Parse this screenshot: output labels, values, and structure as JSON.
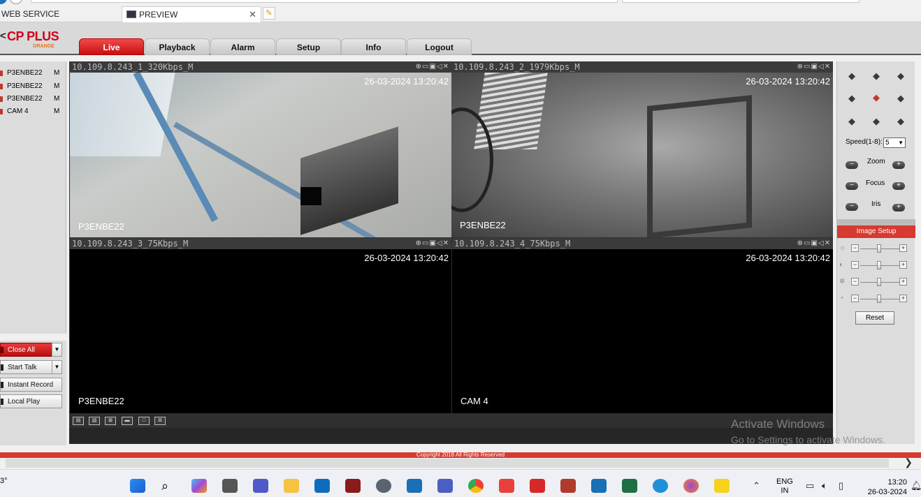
{
  "browser": {
    "tabs": [
      {
        "label": "WEB SERVICE"
      },
      {
        "label": "PREVIEW"
      }
    ]
  },
  "brand": {
    "logo_text": "CP PLUS",
    "logo_sub": "ORANGE"
  },
  "nav": {
    "tabs": [
      "Live",
      "Playback",
      "Alarm",
      "Setup",
      "Info",
      "Logout"
    ],
    "active": "Live"
  },
  "devices": [
    {
      "name": "P3ENBE22",
      "mode": "M"
    },
    {
      "name": "P3ENBE22",
      "mode": "M"
    },
    {
      "name": "P3ENBE22",
      "mode": "M"
    },
    {
      "name": "CAM 4",
      "mode": "M"
    }
  ],
  "left_buttons": {
    "close_all": "Close All",
    "start_talk": "Start Talk",
    "instant_record": "Instant Record",
    "local_play": "Local Play"
  },
  "panes": [
    {
      "stream": "10.109.8.243_1_320Kbps_M",
      "timestamp": "26-03-2024 13:20:42",
      "camera": "P3ENBE22"
    },
    {
      "stream": "10.109.8.243_2_1979Kbps_M",
      "timestamp": "26-03-2024 13:20:42",
      "camera": "P3ENBE22"
    },
    {
      "stream": "10.109.8.243_3_75Kbps_M",
      "timestamp": "26-03-2024 13:20:42",
      "camera": "P3ENBE22"
    },
    {
      "stream": "10.109.8.243_4_75Kbps_M",
      "timestamp": "26-03-2024 13:20:42",
      "camera": "CAM 4"
    }
  ],
  "pane_tools": "⊕▭▣◁✕",
  "ptz": {
    "speed_label": "Speed(1-8):",
    "speed_value": "5",
    "zoom_label": "Zoom",
    "focus_label": "Focus",
    "iris_label": "Iris",
    "image_setup_label": "Image Setup",
    "reset_label": "Reset"
  },
  "image_sliders": [
    {
      "icon": "brightness-icon",
      "level": 0.5
    },
    {
      "icon": "contrast-icon",
      "level": 0.5
    },
    {
      "icon": "saturation-icon",
      "level": 0.5
    },
    {
      "icon": "hue-icon",
      "level": 0.5
    }
  ],
  "footer": {
    "copyright": "Copyright 2018 All Rights Reserved"
  },
  "watermark": {
    "line1": "Activate Windows",
    "line2": "Go to Settings to activate Windows."
  },
  "taskbar": {
    "temp": "3°",
    "lang_line1": "ENG",
    "lang_line2": "IN",
    "time": "13:20",
    "date": "26-03-2024"
  },
  "colors": {
    "accent": "#d63a30",
    "active_tab": "#d0021b",
    "selected_pane": "#2ecc40"
  }
}
